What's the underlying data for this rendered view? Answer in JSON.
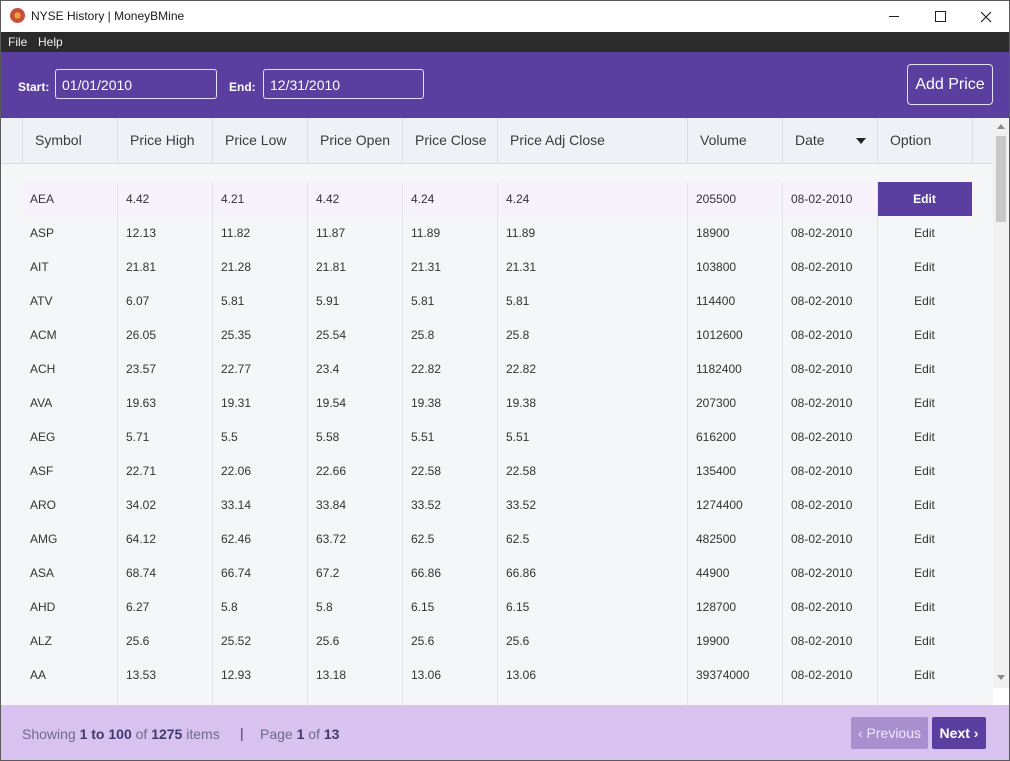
{
  "window": {
    "title": "NYSE History | MoneyBMine"
  },
  "menu": {
    "file": "File",
    "help": "Help"
  },
  "filters": {
    "start_label": "Start:",
    "start_value": "01/01/2010",
    "end_label": "End:",
    "end_value": "12/31/2010",
    "add_price_label": "Add Price"
  },
  "table": {
    "columns": [
      "Symbol",
      "Price High",
      "Price Low",
      "Price Open",
      "Price Close",
      "Price Adj Close",
      "Volume",
      "Date",
      "Option"
    ],
    "sorted_column": "Date",
    "edit_label": "Edit",
    "rows": [
      {
        "symbol": "AEA",
        "high": "4.42",
        "low": "4.21",
        "open": "4.42",
        "close": "4.24",
        "adj_close": "4.24",
        "volume": "205500",
        "date": "08-02-2010",
        "selected": true
      },
      {
        "symbol": "ASP",
        "high": "12.13",
        "low": "11.82",
        "open": "11.87",
        "close": "11.89",
        "adj_close": "11.89",
        "volume": "18900",
        "date": "08-02-2010"
      },
      {
        "symbol": "AIT",
        "high": "21.81",
        "low": "21.28",
        "open": "21.81",
        "close": "21.31",
        "adj_close": "21.31",
        "volume": "103800",
        "date": "08-02-2010"
      },
      {
        "symbol": "ATV",
        "high": "6.07",
        "low": "5.81",
        "open": "5.91",
        "close": "5.81",
        "adj_close": "5.81",
        "volume": "114400",
        "date": "08-02-2010"
      },
      {
        "symbol": "ACM",
        "high": "26.05",
        "low": "25.35",
        "open": "25.54",
        "close": "25.8",
        "adj_close": "25.8",
        "volume": "1012600",
        "date": "08-02-2010"
      },
      {
        "symbol": "ACH",
        "high": "23.57",
        "low": "22.77",
        "open": "23.4",
        "close": "22.82",
        "adj_close": "22.82",
        "volume": "1182400",
        "date": "08-02-2010"
      },
      {
        "symbol": "AVA",
        "high": "19.63",
        "low": "19.31",
        "open": "19.54",
        "close": "19.38",
        "adj_close": "19.38",
        "volume": "207300",
        "date": "08-02-2010"
      },
      {
        "symbol": "AEG",
        "high": "5.71",
        "low": "5.5",
        "open": "5.58",
        "close": "5.51",
        "adj_close": "5.51",
        "volume": "616200",
        "date": "08-02-2010"
      },
      {
        "symbol": "ASF",
        "high": "22.71",
        "low": "22.06",
        "open": "22.66",
        "close": "22.58",
        "adj_close": "22.58",
        "volume": "135400",
        "date": "08-02-2010"
      },
      {
        "symbol": "ARO",
        "high": "34.02",
        "low": "33.14",
        "open": "33.84",
        "close": "33.52",
        "adj_close": "33.52",
        "volume": "1274400",
        "date": "08-02-2010"
      },
      {
        "symbol": "AMG",
        "high": "64.12",
        "low": "62.46",
        "open": "63.72",
        "close": "62.5",
        "adj_close": "62.5",
        "volume": "482500",
        "date": "08-02-2010"
      },
      {
        "symbol": "ASA",
        "high": "68.74",
        "low": "66.74",
        "open": "67.2",
        "close": "66.86",
        "adj_close": "66.86",
        "volume": "44900",
        "date": "08-02-2010"
      },
      {
        "symbol": "AHD",
        "high": "6.27",
        "low": "5.8",
        "open": "5.8",
        "close": "6.15",
        "adj_close": "6.15",
        "volume": "128700",
        "date": "08-02-2010"
      },
      {
        "symbol": "ALZ",
        "high": "25.6",
        "low": "25.52",
        "open": "25.6",
        "close": "25.6",
        "adj_close": "25.6",
        "volume": "19900",
        "date": "08-02-2010"
      },
      {
        "symbol": "AA",
        "high": "13.53",
        "low": "12.93",
        "open": "13.18",
        "close": "13.06",
        "adj_close": "13.06",
        "volume": "39374000",
        "date": "08-02-2010"
      }
    ]
  },
  "pagination": {
    "showing_prefix": "Showing",
    "range": "1 to 100",
    "of_word": "of",
    "total": "1275",
    "items_word": "items",
    "separator": "|",
    "page_word": "Page",
    "current_page": "1",
    "total_pages": "13",
    "previous_label": "‹ Previous",
    "next_label": "Next ›"
  },
  "colors": {
    "accent": "#5b3fa0",
    "footer": "#d7c2f0",
    "selected_row": "#f7f2fc"
  },
  "icons": {
    "app": "app-logo-icon",
    "sort": "sort-down-icon"
  }
}
